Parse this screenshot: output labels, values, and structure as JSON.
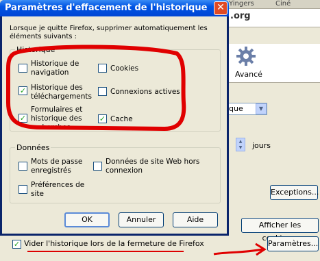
{
  "background": {
    "tab1": "Yingers",
    "tab2": "Ciné",
    "site_suffix": ".org",
    "advanced_label": "Avancé",
    "combo_text": "que",
    "days_label": "jours",
    "exceptions_button": "Exceptions...",
    "cookies_button": "Afficher les cookies...",
    "parameters_button": "Paramètres...",
    "clear_history_checkbox": {
      "label": "Vider l'historique lors de la fermeture de Firefox",
      "checked": true
    }
  },
  "dialog": {
    "title": "Paramètres d'effacement de l'historique",
    "close_glyph": "✕",
    "intro_text": "Lorsque je quitte Firefox, supprimer automatiquement les éléments suivants :",
    "history_group": {
      "legend": "Historique",
      "items": [
        {
          "label": "Historique de navigation",
          "checked": false
        },
        {
          "label": "Cookies",
          "checked": false
        },
        {
          "label": "Historique des téléchargements",
          "checked": true
        },
        {
          "label": "Connexions actives",
          "checked": false
        },
        {
          "label": "Formulaires et historique des recherches",
          "checked": true
        },
        {
          "label": "Cache",
          "checked": true
        }
      ]
    },
    "data_group": {
      "legend": "Données",
      "items": [
        {
          "label": "Mots de passe enregistrés",
          "checked": false
        },
        {
          "label": "Données de site Web hors connexion",
          "checked": false
        },
        {
          "label": "Préférences de site",
          "checked": false
        }
      ]
    },
    "buttons": {
      "ok": "OK",
      "cancel": "Annuler",
      "help": "Aide"
    }
  },
  "check_glyph": "✓",
  "colors": {
    "annotation_red": "#e00000",
    "titlebar_blue": "#0054e3",
    "check_green": "#21a121"
  }
}
